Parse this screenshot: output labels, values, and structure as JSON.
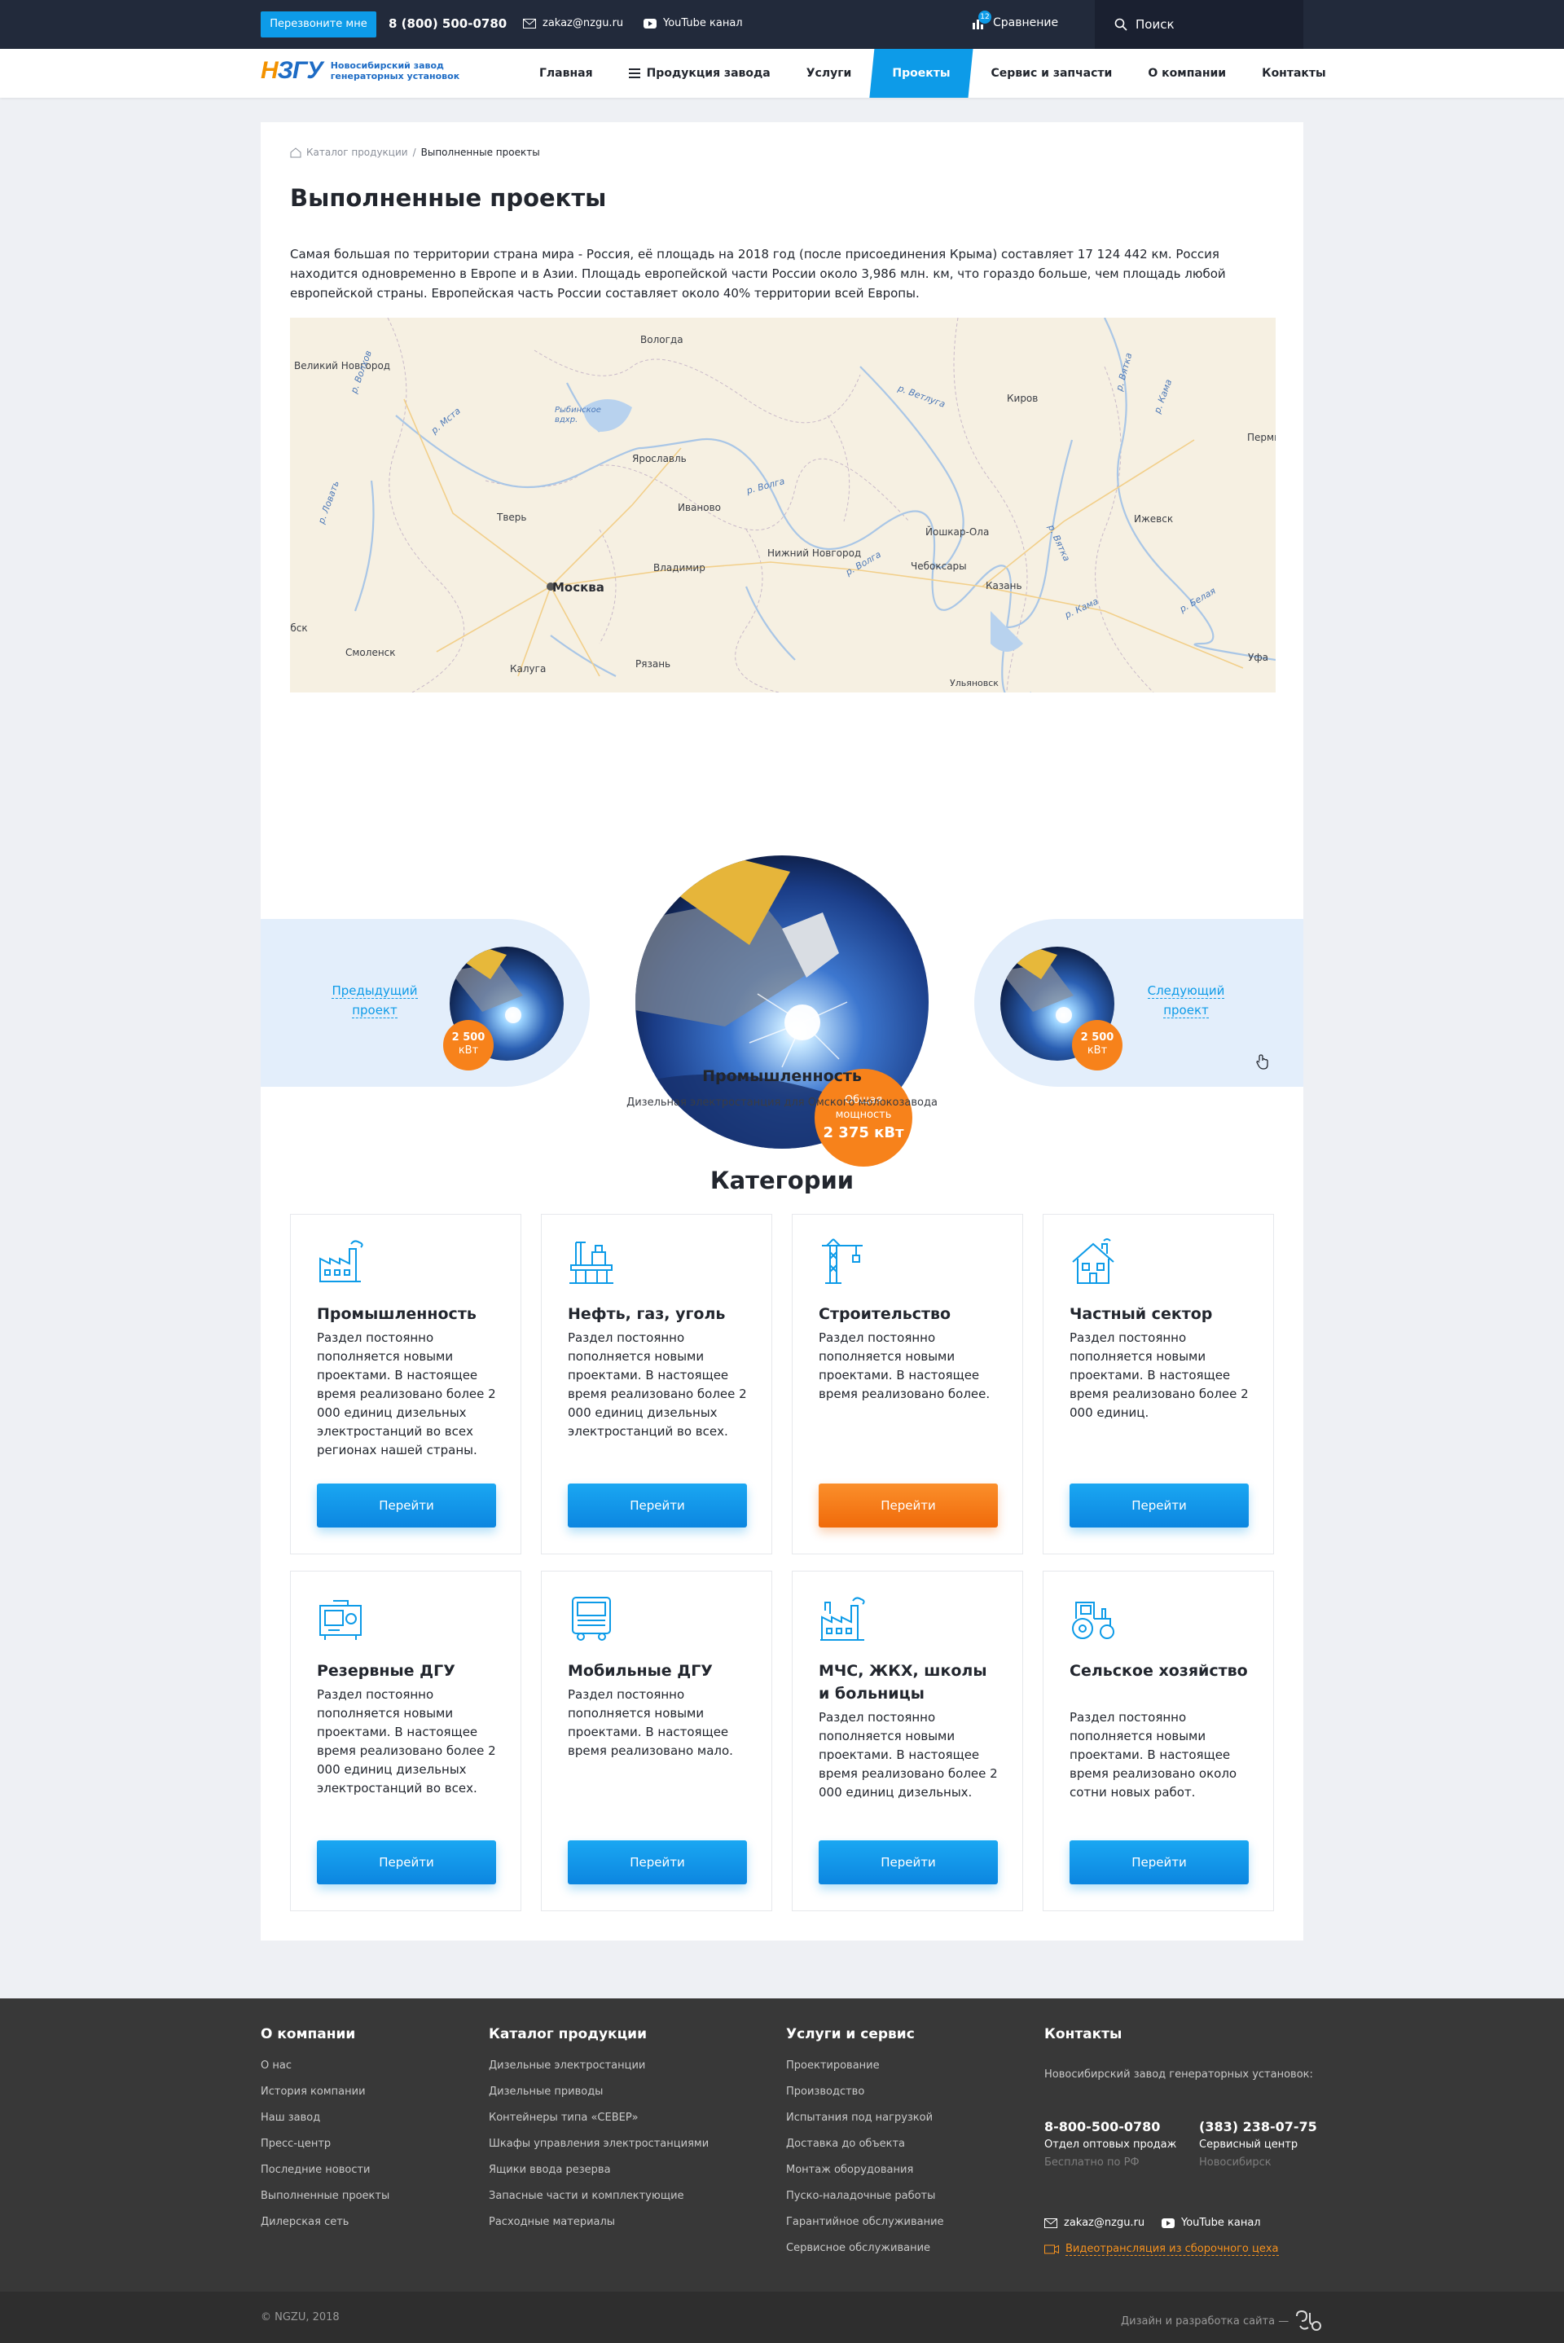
{
  "topbar": {
    "callback_label": "Перезвоните мне",
    "phone": "8 (800) 500-0780",
    "email": "zakaz@nzgu.ru",
    "youtube": "YouTube канал",
    "compare_label": "Сравнение",
    "compare_count": "12",
    "search_label": "Поиск"
  },
  "logo": {
    "mark_a": "Н",
    "mark_b": "ЗГУ",
    "line1": "Новосибирский завод",
    "line2": "генераторных установок"
  },
  "nav": {
    "items": [
      "Главная",
      "Продукция завода",
      "Услуги",
      "Проекты",
      "Сервис и запчасти",
      "О компании",
      "Контакты"
    ],
    "active": "Проекты"
  },
  "breadcrumb": {
    "home": "Каталог продукции",
    "current": "Выполненные проекты"
  },
  "page": {
    "title": "Выполненные проекты",
    "intro": "Самая большая по территории страна мира - Россия, её площадь на 2018 год (после присоединения Крыма) составляет 17 124 442 км. Россия находится одновременно в Европе и в Азии. Площадь европейской части России около 3,986 млн. км, что гораздо больше, чем площадь любой европейской страны. Европейская часть России составляет около 40% территории всей Европы."
  },
  "map": {
    "cities": [
      "Вологда",
      "Великий Новгород",
      "Рыбинское вдхр.",
      "Ярославль",
      "Киров",
      "Пермь",
      "Тверь",
      "Иваново",
      "Йошкар-Ола",
      "Ижевск",
      "Нижний Новгород",
      "Чебоксары",
      "Владимир",
      "Москва",
      "Казань",
      "Смоленск",
      "Калуга",
      "Рязань",
      "Ульяновск",
      "Уфа",
      "Витебск"
    ],
    "rivers": [
      "р. Волхов",
      "р. Мста",
      "р. Ветлуга",
      "р. Вятка",
      "р. Кама",
      "р. Ловать",
      "р. Волга",
      "р. Волга",
      "р. Вятка",
      "р. Кама",
      "р. Белая"
    ]
  },
  "slider": {
    "prev_label": "Предыдущий проект",
    "next_label": "Следующий проект",
    "side_badge_value": "2 500",
    "side_badge_unit": "кВт",
    "total_label": "Общая мощность",
    "total_value": "2 375 кВт",
    "project_title": "Промышленность",
    "project_subtitle": "Дизельная электростанция для Омского молокозавода"
  },
  "categories": {
    "title": "Категории",
    "button_label": "Перейти",
    "items": [
      {
        "name": "Промышленность",
        "desc": "Раздел постоянно пополняется новыми проектами. В настоящее время реализовано более 2 000 единиц дизельных электростанций во всех регионах нашей страны.",
        "icon": "factory-icon"
      },
      {
        "name": "Нефть, газ, уголь",
        "desc": "Раздел постоянно пополняется новыми проектами. В настоящее время реализовано более 2 000 единиц дизельных электростанций во всех.",
        "icon": "oil-rig-icon"
      },
      {
        "name": "Строительство",
        "desc": "Раздел постоянно пополняется новыми проектами. В настоящее время реализовано более.",
        "icon": "crane-icon"
      },
      {
        "name": "Частный сектор",
        "desc": "Раздел постоянно пополняется новыми проектами. В настоящее время реализовано более 2 000 единиц.",
        "icon": "house-icon"
      },
      {
        "name": "Резервные ДГУ",
        "desc": "Раздел постоянно пополняется новыми проектами. В настоящее время реализовано более 2 000 единиц дизельных электростанций во всех.",
        "icon": "generator-icon"
      },
      {
        "name": "Мобильные ДГУ",
        "desc": "Раздел постоянно пополняется новыми проектами. В настоящее время реализовано мало.",
        "icon": "truck-icon"
      },
      {
        "name": "МЧС, ЖКХ, школы и больницы",
        "desc": "Раздел постоянно пополняется новыми проектами. В настоящее время реализовано более 2 000 единиц дизельных.",
        "icon": "public-buildings-icon"
      },
      {
        "name": "Сельское хозяйство",
        "desc": "Раздел постоянно пополняется новыми проектами. В настоящее время реализовано около сотни новых работ.",
        "icon": "tractor-icon"
      }
    ]
  },
  "footer": {
    "col1": {
      "title": "О компании",
      "links": [
        "О нас",
        "История компании",
        "Наш завод",
        "Пресс-центр",
        "Последние новости",
        "Выполненные проекты",
        "Дилерская сеть"
      ]
    },
    "col2": {
      "title": "Каталог продукции",
      "links": [
        "Дизельные электростанции",
        "Дизельные приводы",
        "Контейнеры типа «СЕВЕР»",
        "Шкафы управления электростанциями",
        "Ящики ввода резерва",
        "Запасные части и комплектующие",
        "Расходные материалы"
      ]
    },
    "col3": {
      "title": "Услуги и сервис",
      "links": [
        "Проектирование",
        "Производство",
        "Испытания под нагрузкой",
        "Доставка до объекта",
        "Монтаж оборудования",
        "Пуско-наладочные работы",
        "Гарантийное обслуживание",
        "Сервисное обслуживание"
      ]
    },
    "contacts": {
      "title": "Контакты",
      "org": "Новосибирский завод генераторных установок:",
      "phone1": "8-800-500-0780",
      "phone1_sub": "Отдел оптовых продаж",
      "phone1_note": "Бесплатно по РФ",
      "phone2": "(383) 238-07-75",
      "phone2_sub": "Сервисный центр",
      "phone2_note": "Новосибирск",
      "email": "zakaz@nzgu.ru",
      "youtube": "YouTube канал",
      "video": "Видеотрансляция из сборочного цеха"
    },
    "copyright": "© NGZU, 2018",
    "dev": "Дизайн и разработка сайта —"
  },
  "colors": {
    "accent": "#0d9be8",
    "orange": "#f7821b",
    "topbar": "#222a3b",
    "footer": "#383838"
  }
}
